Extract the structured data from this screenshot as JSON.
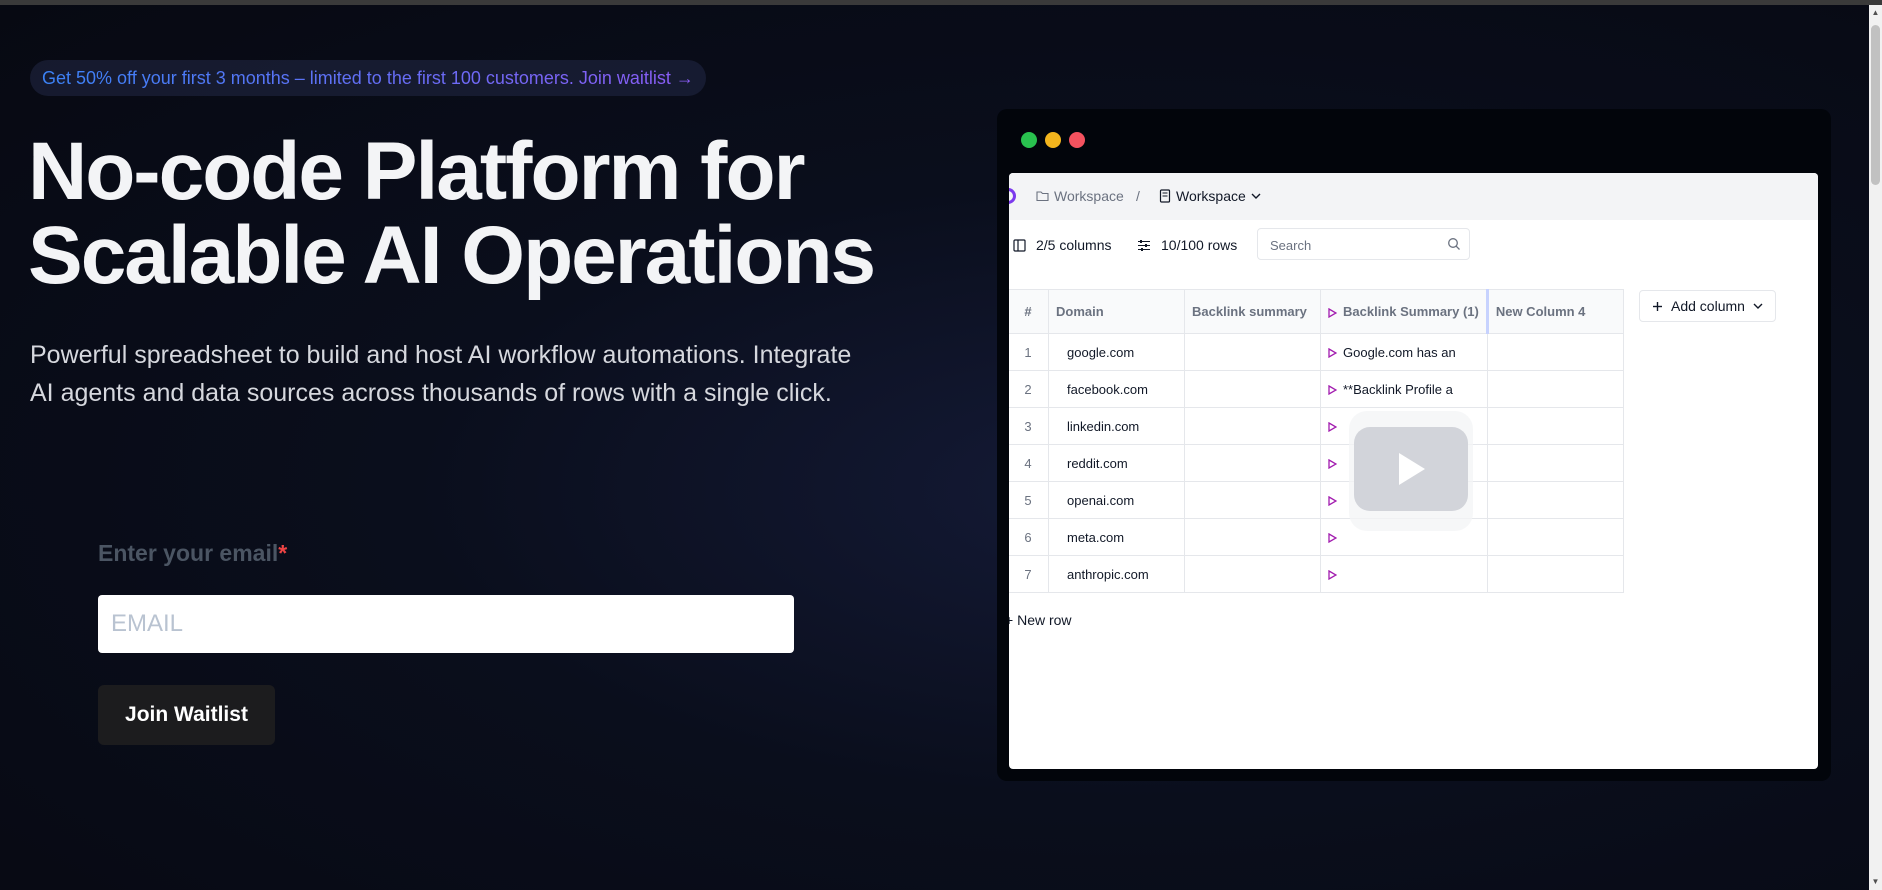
{
  "promo": {
    "text": "Get 50% off your first 3 months – limited to the first 100 customers. Join waitlist →"
  },
  "hero": {
    "title_line1": "No-code Platform for",
    "title_line2": "Scalable AI Operations",
    "subtitle": "Powerful spreadsheet to build and host AI workflow automations. Integrate AI agents and data sources across thousands of rows with a single click."
  },
  "form": {
    "label": "Enter your email",
    "required_mark": "*",
    "email_placeholder": "EMAIL",
    "email_value": "",
    "submit_label": "Join Waitlist"
  },
  "app": {
    "breadcrumb": {
      "folder": "Workspace",
      "separator": "/",
      "current": "Workspace"
    },
    "toolbar": {
      "columns": "2/5 columns",
      "rows": "10/100 rows",
      "search_placeholder": "Search"
    },
    "table": {
      "headers": [
        "#",
        "Domain",
        "Backlink summary",
        "Backlink Summary (1)",
        "New Column 4"
      ],
      "rows": [
        {
          "num": "1",
          "domain": "google.com",
          "summary": "Google.com has an"
        },
        {
          "num": "2",
          "domain": "facebook.com",
          "summary": "**Backlink Profile a"
        },
        {
          "num": "3",
          "domain": "linkedin.com",
          "summary": ""
        },
        {
          "num": "4",
          "domain": "reddit.com",
          "summary": ""
        },
        {
          "num": "5",
          "domain": "openai.com",
          "summary": ""
        },
        {
          "num": "6",
          "domain": "meta.com",
          "summary": ""
        },
        {
          "num": "7",
          "domain": "anthropic.com",
          "summary": ""
        }
      ]
    },
    "add_column_label": "Add column",
    "new_row_label": "New row"
  },
  "icons": [
    "folder-icon",
    "document-icon",
    "chevron-down-icon",
    "columns-icon",
    "sliders-icon",
    "search-icon",
    "play-icon",
    "plus-icon"
  ],
  "colors": {
    "accent_blue": "#3b82f6",
    "accent_purple": "#8b5cf6",
    "required_red": "#ef4444",
    "play_purple": "#a21caf"
  }
}
